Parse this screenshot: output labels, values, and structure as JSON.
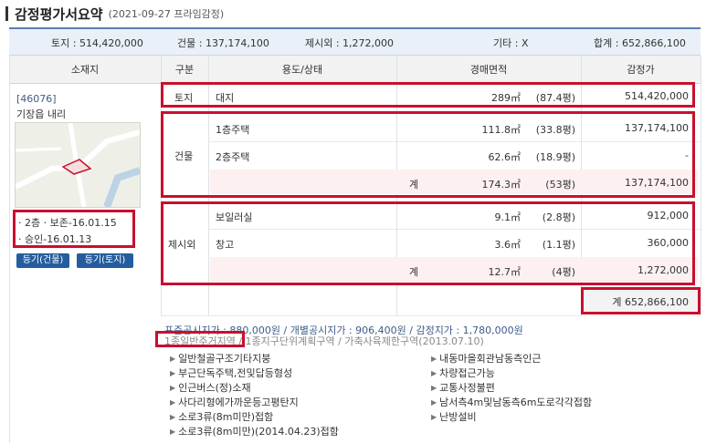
{
  "header": {
    "title": "감정평가서요약",
    "subtitle": "(2021-09-27  프라임감정)"
  },
  "summary": {
    "land": "토지 : 514,420,000",
    "building": "건물 : 137,174,100",
    "excluded": "제시외 : 1,272,000",
    "other": "기타 : X",
    "total": "합계 : 652,866,100"
  },
  "columns": [
    "소재지",
    "구분",
    "용도/상태",
    "경매면적",
    "감정가"
  ],
  "location": {
    "zip": "[46076]",
    "address": "기장읍 내리",
    "floor_line": "· 2층  · 보존-16.01.15",
    "approval_line": "· 승인-16.01.13",
    "btn_building": "등기(건물)",
    "btn_land": "등기(토지)"
  },
  "land": {
    "cat": "토지",
    "use": "대지",
    "area": "289㎡",
    "pyeong": "(87.4평)",
    "price": "514,420,000"
  },
  "building": {
    "cat": "건물",
    "rows": [
      {
        "use": "1층주택",
        "area": "111.8㎡",
        "pyeong": "(33.8평)",
        "price": "137,174,100"
      },
      {
        "use": "2층주택",
        "area": "62.6㎡",
        "pyeong": "(18.9평)",
        "price": "-"
      }
    ],
    "sum_label": "계",
    "sum_area": "174.3㎡",
    "sum_pyeong": "(53평)",
    "sum_price": "137,174,100"
  },
  "excluded": {
    "cat": "제시외",
    "rows": [
      {
        "use": "보일러실",
        "area": "9.1㎡",
        "pyeong": "(2.8평)",
        "price": "912,000"
      },
      {
        "use": "창고",
        "area": "3.6㎡",
        "pyeong": "(1.1평)",
        "price": "360,000"
      }
    ],
    "sum_label": "계",
    "sum_area": "12.7㎡",
    "sum_pyeong": "(4평)",
    "sum_price": "1,272,000"
  },
  "grand_total": "계 652,866,100",
  "info": {
    "prices": "표준공시지가 : 880,000원 / 개별공시지가 : 906,400원 / 감정지가 : 1,780,000원",
    "zone_hl": "1종일반주거지역",
    "zone_rest": " / 1종지구단위계획구역 / 가축사육제한구역(2013.07.10)"
  },
  "bullets_left": [
    "일반철골구조기타지붕",
    "부근단독주택,전및답등형성",
    "인근버스(정)소재",
    "사다리형에가까운등고평탄지",
    "소로3류(8m미만)접함",
    "소로3류(8m미만)(2014.04.23)접함"
  ],
  "bullets_right": [
    "내동마을회관남동측인근",
    "차량접근가능",
    "교통사정불편",
    "남서측4m및남동측6m도로각각접함",
    "난방설비"
  ],
  "colors": {
    "accent": "#5b7fb1",
    "highlight": "#c8102e",
    "badge": "#245c9e"
  }
}
